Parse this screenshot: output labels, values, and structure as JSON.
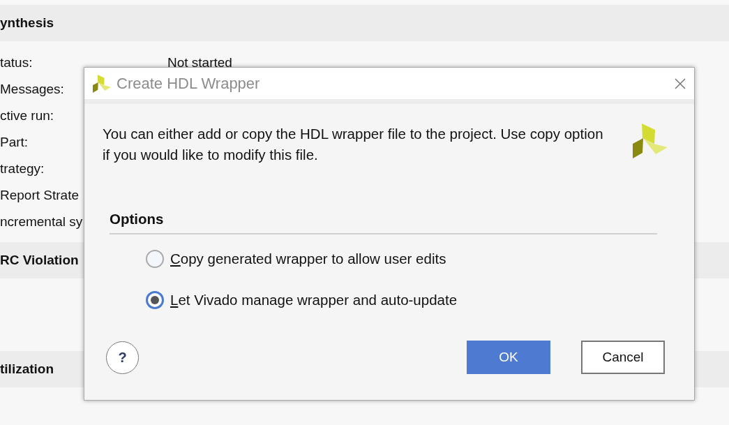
{
  "background": {
    "sections": [
      {
        "title": "ynthesis",
        "rows": [
          {
            "label": "tatus:",
            "value": "Not started"
          },
          {
            "label": "Messages:"
          },
          {
            "label": "ctive run:"
          },
          {
            "label": "Part:"
          },
          {
            "label": "trategy:"
          },
          {
            "label": "Report Strate"
          },
          {
            "label": "ncremental sy"
          }
        ]
      },
      {
        "title": "RC Violation"
      },
      {
        "title": "tilization"
      }
    ]
  },
  "dialog": {
    "title": "Create HDL Wrapper",
    "message": "You can either add or copy the HDL wrapper file to the project. Use copy option if you would like to modify this file.",
    "options_heading": "Options",
    "options": [
      {
        "label": "Copy generated wrapper to allow user edits",
        "selected": false,
        "mnemonic_first": true
      },
      {
        "label": "Let Vivado manage wrapper and auto-update",
        "selected": true,
        "mnemonic_first": true
      }
    ],
    "help": "?",
    "buttons": [
      {
        "label": "OK",
        "kind": "primary"
      },
      {
        "label": "Cancel",
        "kind": "secondary"
      }
    ]
  }
}
